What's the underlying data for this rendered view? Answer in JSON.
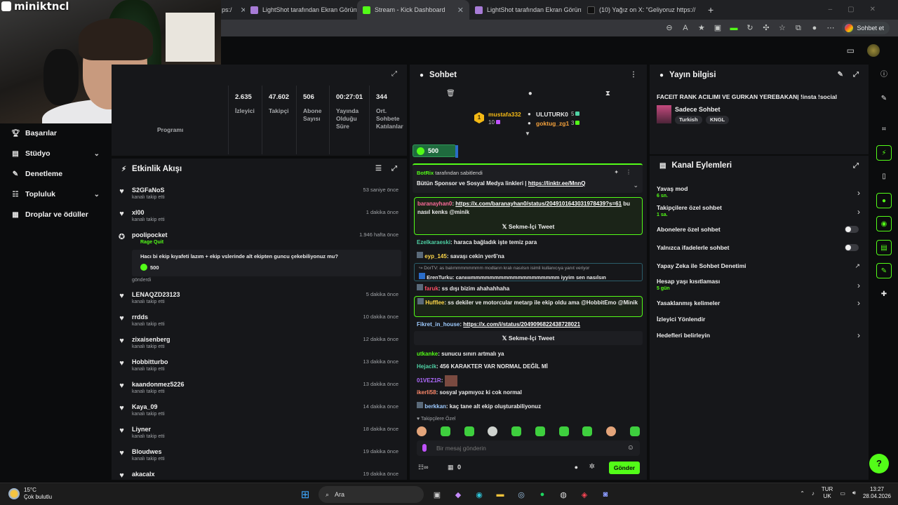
{
  "browser": {
    "tabs": [
      {
        "label": "ps:/",
        "icon_color": "#3c8eff"
      },
      {
        "label": "LightShot tarafından Ekran Görünt",
        "icon_color": "#a77bd6"
      },
      {
        "label": "Stream - Kick Dashboard",
        "icon_color": "#53fc18"
      },
      {
        "label": "LightShot tarafından Ekran Görünt",
        "icon_color": "#a77bd6"
      },
      {
        "label": "(10) Yağız on X: \"Geliyoruz https://",
        "icon_color": "#000000"
      }
    ],
    "new_tab": "+",
    "chat_button": "Sohbet et"
  },
  "webcam": {
    "name": "miniktncl"
  },
  "sidebar": {
    "items": [
      {
        "label": "Başarılar",
        "icon": "trophy-icon"
      },
      {
        "label": "Stüdyo",
        "icon": "studio-icon",
        "chevron": "⌄"
      },
      {
        "label": "Denetleme",
        "icon": "wrench-icon"
      },
      {
        "label": "Topluluk",
        "icon": "community-icon",
        "chevron": "⌄"
      },
      {
        "label": "Droplar ve ödüller",
        "icon": "gift-icon"
      }
    ]
  },
  "stats": {
    "partial_label": "Programı",
    "columns": [
      {
        "value": "2.635",
        "label": "İzleyici"
      },
      {
        "value": "47.602",
        "label": "Takipçi"
      },
      {
        "value": "506",
        "label": "Abone Sayısı"
      },
      {
        "value": "00:27:01",
        "label": "Yayında Olduğu Süre"
      },
      {
        "value": "344",
        "label": "Ort. Sohbete Katılanlar"
      }
    ]
  },
  "feed": {
    "title": "Etkinlik Akışı",
    "items": [
      {
        "name": "S2GFaNoS",
        "sub": "kanalı takip etti",
        "time": "53 saniye önce"
      },
      {
        "name": "xl00",
        "sub": "kanalı takip etti",
        "time": "1 dakika önce"
      },
      {
        "name": "poolipocket",
        "sub": "gönderdi",
        "time": "1.946 hafta önce",
        "reward_title": "Rage Quit",
        "reward_msg": "Hacı bi ekip kıyafeti lazım + ekip vslerinde alt ekipten guncu çekebiliyonuz mu?",
        "reward_amount": "500"
      },
      {
        "name": "LENAQZD23123",
        "sub": "kanalı takip etti",
        "time": "5 dakika önce"
      },
      {
        "name": "rrdds",
        "sub": "kanalı takip etti",
        "time": "10 dakika önce"
      },
      {
        "name": "zixaisenberg",
        "sub": "kanalı takip etti",
        "time": "12 dakika önce"
      },
      {
        "name": "Hobbitturbo",
        "sub": "kanalı takip etti",
        "time": "13 dakika önce"
      },
      {
        "name": "kaandonmez5226",
        "sub": "kanalı takip etti",
        "time": "13 dakika önce"
      },
      {
        "name": "Kaya_09",
        "sub": "kanalı takip etti",
        "time": "14 dakika önce"
      },
      {
        "name": "Liyner",
        "sub": "kanalı takip etti",
        "time": "18 dakika önce"
      },
      {
        "name": "Bloudwes",
        "sub": "kanalı takip etti",
        "time": "19 dakika önce"
      },
      {
        "name": "akacalx",
        "sub": "",
        "time": "19 dakika önce"
      }
    ]
  },
  "chat": {
    "title": "Sohbet",
    "leaderboard": {
      "rank": "1",
      "first": {
        "name": "mustafa332",
        "count": "10"
      },
      "second": {
        "name": "ULUTURK0",
        "count": "5"
      },
      "third": {
        "name": "goktug_zg1",
        "count": "3"
      }
    },
    "balance": "500",
    "pinned": {
      "by": "BotRix",
      "by_suffix": "tarafından sabitlendi",
      "text": "Bütün Sponsor ve Sosyal Medya linkleri |",
      "link": "https://linktr.ee/MnnQ"
    },
    "messages": [
      {
        "user": "baranayhan0",
        "color": "#ff6b9a",
        "text": "",
        "link": "https://x.com/baranayhan0/status/2049101643031978439?s=61",
        "after": " bu nasıl kenks @minik"
      },
      {
        "user": "Ezelkaraeski",
        "color": "#4fd1a5",
        "text": ": haraca bağladık işte temiz para"
      },
      {
        "user": "eyp_145",
        "color": "#ffd84a",
        "text": ": savaşı cekin yer6'na"
      },
      {
        "user": "Hufflee",
        "color": "#ffd84a",
        "text": ": ss dekiler ve motorcular metarp ile ekip oldu ama @HobbitEmo @Minik"
      },
      {
        "user": "faruk",
        "color": "#ff4f64",
        "text": ": ss dışı bizim ahahahhaha"
      },
      {
        "user": "Fikret_in_house",
        "color": "#9ecbff",
        "text": ": ",
        "link": "https://x.com/i/status/2049096822438728021"
      },
      {
        "user": "utkanke",
        "color": "#53fc18",
        "text": ": sunucu sınırı artmalı ya"
      },
      {
        "user": "Hejacik",
        "color": "#4fd1a5",
        "text": ": 456 KARAKTER VAR NORMAL DEĞİL Mİ"
      },
      {
        "user": "01VEZ1R",
        "color": "#b06bff",
        "text": ":"
      },
      {
        "user": "ikerli58",
        "color": "#ff8a6b",
        "text": ": sosyal yapmıyoz ki cok normal"
      },
      {
        "user": "berkkan",
        "color": "#9ecbff",
        "text": ": kaç tane alt ekip oluşturabiliyonuz"
      }
    ],
    "tweet_label": "Sekme-İçi Tweet",
    "reply": {
      "quote": "DorTV: as balımmmmmmmm modların kralı nasılsın isimli kullanıcıya yanıt veriyor",
      "user": "ErenTurku",
      "text": ": canıııımmmmmmmmmmmmmmmmmmm iyyim sen nasılsın"
    },
    "follower_only": "Takipçilere Özel",
    "input_placeholder": "Bir mesaj gönderin",
    "points": "0",
    "send": "Gönder"
  },
  "info": {
    "title": "Yayın bilgisi",
    "stream_title": "FACEIT RANK ACILIMI VE GURKAN YEREBAKAN| !insta !social",
    "category": "Sadece Sohbet",
    "tags": [
      "Turkish",
      "KNGL"
    ]
  },
  "actions": {
    "title": "Kanal Eylemleri",
    "items": [
      {
        "label": "Yavaş mod",
        "sub": "6 sn.",
        "kind": "chevron"
      },
      {
        "label": "Takipçilere özel sohbet",
        "sub": "1 sa.",
        "kind": "chevron"
      },
      {
        "label": "Abonelere özel sohbet",
        "sub": "",
        "kind": "toggle"
      },
      {
        "label": "Yalnızca ifadelerle sohbet",
        "sub": "",
        "kind": "toggle"
      },
      {
        "label": "Yapay Zeka ile Sohbet Denetimi",
        "sub": "",
        "kind": "external"
      },
      {
        "label": "Hesap yaşı kısıtlaması",
        "sub": "5 gün",
        "kind": "chevron"
      },
      {
        "label": "Yasaklanmış kelimeler",
        "sub": "",
        "kind": "chevron"
      },
      {
        "label": "İzleyici Yönlendir",
        "sub": "",
        "kind": "none"
      },
      {
        "label": "Hedefleri belirleyin",
        "sub": "",
        "kind": "chevron"
      }
    ]
  },
  "taskbar": {
    "temp": "15°C",
    "weather": "Çok bulutlu",
    "search": "Ara",
    "lang_top": "TUR",
    "lang_bottom": "UK",
    "time": "13:27",
    "date": "28.04.2026"
  },
  "colors": {
    "accent": "#53fc18",
    "panel": "#16171a",
    "bg": "#0b0c0d"
  }
}
